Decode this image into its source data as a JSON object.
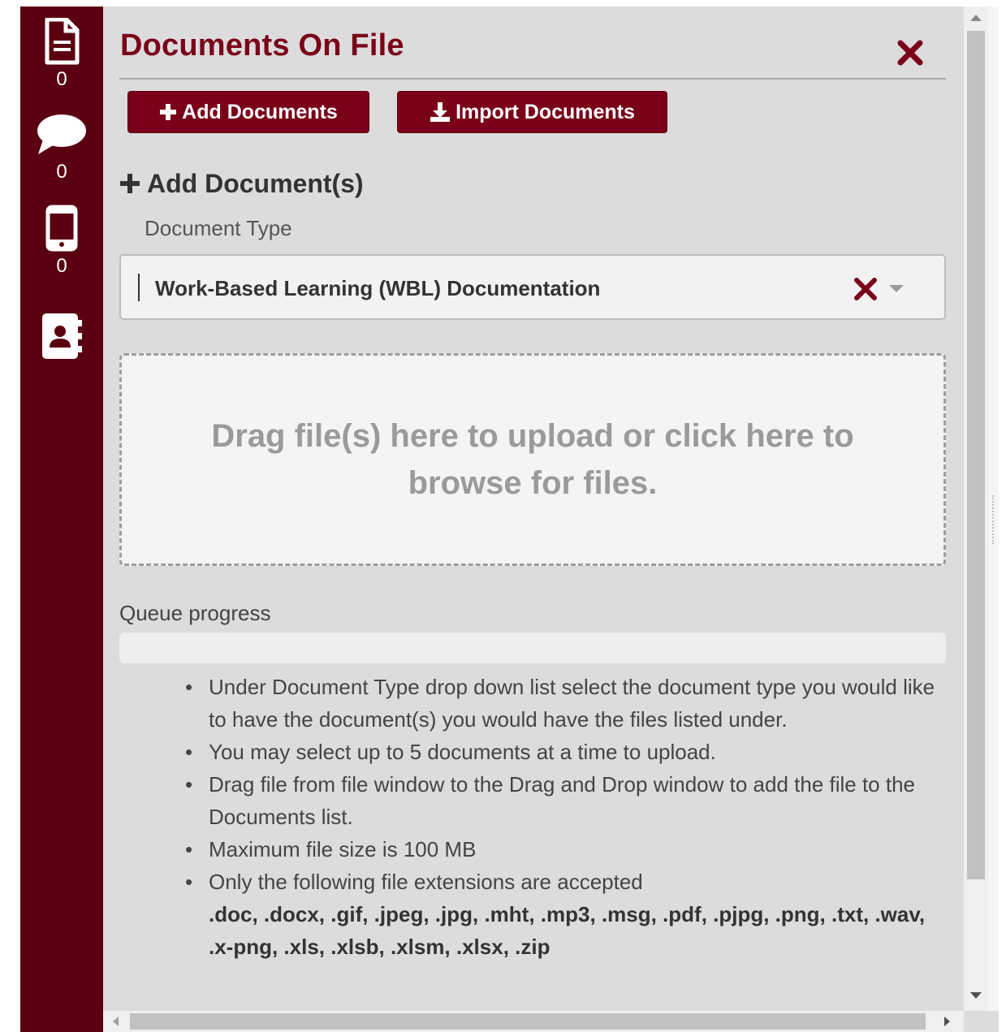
{
  "sidebar": {
    "items": [
      {
        "icon": "document-icon",
        "count": "0"
      },
      {
        "icon": "chat-bubble-icon",
        "count": "0"
      },
      {
        "icon": "mobile-phone-icon",
        "count": "0"
      },
      {
        "icon": "contact-book-icon"
      }
    ],
    "color": "#5a0011"
  },
  "panel": {
    "title": "Documents On File",
    "close_icon": "close-icon",
    "buttons": {
      "add_documents": "Add Documents",
      "import_documents": "Import Documents"
    },
    "section_heading": "Add Document(s)",
    "document_type_label": "Document Type",
    "document_type_value": "Work-Based Learning (WBL) Documentation",
    "dropzone_text": "Drag file(s) here to upload or click here to browse for files.",
    "queue_label": "Queue progress",
    "queue_progress_percent": 0,
    "notes": [
      "Under Document Type drop down list select the document type you would like to have the document(s) you would have the files listed under.",
      "You may select up to 5 documents at a time to upload.",
      "Drag file from file window to the Drag and Drop window to add the file to the Documents list.",
      "Maximum file size is 100 MB",
      "Only the following file extensions are accepted"
    ],
    "accepted_extensions": ".doc, .docx, .gif, .jpeg, .jpg, .mht, .mp3, .msg, .pdf, .pjpg, .png, .txt, .wav, .x-png, .xls, .xlsb, .xlsm, .xlsx, .zip"
  },
  "colors": {
    "accent": "#7a0019",
    "panel_bg": "#dcdcdc"
  }
}
